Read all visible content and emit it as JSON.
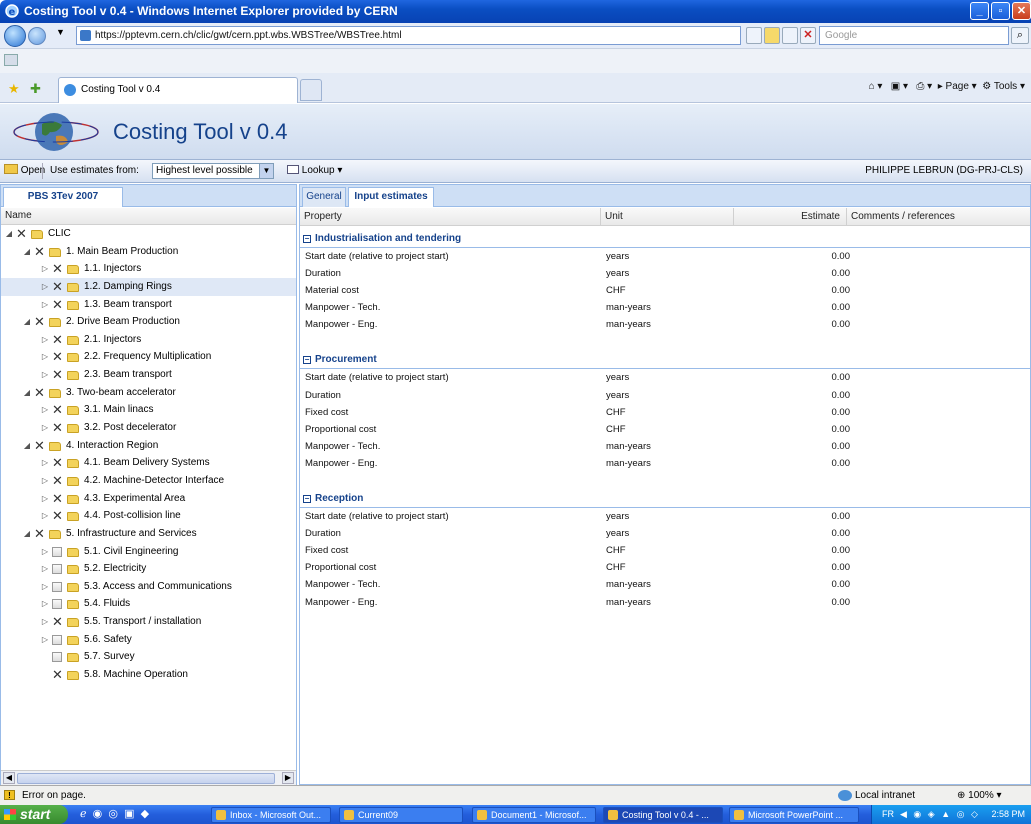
{
  "window": {
    "title": "Costing Tool v 0.4 - Windows Internet Explorer provided by CERN"
  },
  "browser": {
    "url": "https://pptevm.cern.ch/clic/gwt/cern.ppt.wbs.WBSTree/WBSTree.html",
    "search_placeholder": "Google",
    "tab_title": "Costing Tool v 0.4",
    "page_menu": "Page",
    "tools_menu": "Tools"
  },
  "app": {
    "title": "Costing Tool v 0.4",
    "open_label": "Open",
    "estimates_label": "Use estimates from:",
    "estimates_value": "Highest level possible",
    "lookup_label": "Lookup",
    "user": "PHILIPPE LEBRUN (DG-PRJ-CLS)"
  },
  "left_panel": {
    "tab": "PBS 3Tev 2007",
    "column": "Name",
    "tree": [
      {
        "label": "CLIC",
        "level": 0,
        "toggle": "expanded",
        "marker": "x"
      },
      {
        "label": "1. Main Beam Production",
        "level": 1,
        "toggle": "expanded",
        "marker": "x"
      },
      {
        "label": "1.1. Injectors",
        "level": 2,
        "toggle": "collapsed",
        "marker": "x"
      },
      {
        "label": "1.2. Damping Rings",
        "level": 2,
        "toggle": "collapsed",
        "marker": "x",
        "selected": true
      },
      {
        "label": "1.3. Beam transport",
        "level": 2,
        "toggle": "collapsed",
        "marker": "x"
      },
      {
        "label": "2. Drive Beam Production",
        "level": 1,
        "toggle": "expanded",
        "marker": "x"
      },
      {
        "label": "2.1. Injectors",
        "level": 2,
        "toggle": "collapsed",
        "marker": "x"
      },
      {
        "label": "2.2. Frequency Multiplication",
        "level": 2,
        "toggle": "collapsed",
        "marker": "x"
      },
      {
        "label": "2.3. Beam transport",
        "level": 2,
        "toggle": "collapsed",
        "marker": "x"
      },
      {
        "label": "3. Two-beam accelerator",
        "level": 1,
        "toggle": "expanded",
        "marker": "x"
      },
      {
        "label": "3.1. Main linacs",
        "level": 2,
        "toggle": "collapsed",
        "marker": "x"
      },
      {
        "label": "3.2. Post decelerator",
        "level": 2,
        "toggle": "collapsed",
        "marker": "x"
      },
      {
        "label": "4. Interaction Region",
        "level": 1,
        "toggle": "expanded",
        "marker": "x"
      },
      {
        "label": "4.1. Beam Delivery Systems",
        "level": 2,
        "toggle": "collapsed",
        "marker": "x"
      },
      {
        "label": "4.2. Machine-Detector Interface",
        "level": 2,
        "toggle": "collapsed",
        "marker": "x"
      },
      {
        "label": "4.3. Experimental Area",
        "level": 2,
        "toggle": "collapsed",
        "marker": "x"
      },
      {
        "label": "4.4. Post-collision line",
        "level": 2,
        "toggle": "collapsed",
        "marker": "x"
      },
      {
        "label": "5. Infrastructure and Services",
        "level": 1,
        "toggle": "expanded",
        "marker": "x"
      },
      {
        "label": "5.1. Civil Engineering",
        "level": 2,
        "toggle": "collapsed",
        "marker": "box"
      },
      {
        "label": "5.2. Electricity",
        "level": 2,
        "toggle": "collapsed",
        "marker": "box"
      },
      {
        "label": "5.3. Access and Communications",
        "level": 2,
        "toggle": "collapsed",
        "marker": "box"
      },
      {
        "label": "5.4. Fluids",
        "level": 2,
        "toggle": "collapsed",
        "marker": "box"
      },
      {
        "label": "5.5. Transport / installation",
        "level": 2,
        "toggle": "collapsed",
        "marker": "x"
      },
      {
        "label": "5.6. Safety",
        "level": 2,
        "toggle": "collapsed",
        "marker": "box"
      },
      {
        "label": "5.7. Survey",
        "level": 2,
        "toggle": "none",
        "marker": "box"
      },
      {
        "label": "5.8. Machine Operation",
        "level": 2,
        "toggle": "none",
        "marker": "x"
      }
    ]
  },
  "right_panel": {
    "tabs": [
      {
        "label": "General",
        "active": false
      },
      {
        "label": "Input estimates",
        "active": true
      }
    ],
    "columns": [
      "Property",
      "Unit",
      "Estimate",
      "Comments / references"
    ],
    "groups": [
      {
        "title": "Industrialisation and tendering",
        "rows": [
          {
            "property": "Start date (relative to project start)",
            "unit": "years",
            "estimate": "0.00"
          },
          {
            "property": "Duration",
            "unit": "years",
            "estimate": "0.00"
          },
          {
            "property": "Material cost",
            "unit": "CHF",
            "estimate": "0.00"
          },
          {
            "property": "Manpower - Tech.",
            "unit": "man-years",
            "estimate": "0.00"
          },
          {
            "property": "Manpower - Eng.",
            "unit": "man-years",
            "estimate": "0.00"
          }
        ]
      },
      {
        "title": "Procurement",
        "rows": [
          {
            "property": "Start date (relative to project start)",
            "unit": "years",
            "estimate": "0.00"
          },
          {
            "property": "Duration",
            "unit": "years",
            "estimate": "0.00"
          },
          {
            "property": "Fixed cost",
            "unit": "CHF",
            "estimate": "0.00"
          },
          {
            "property": "Proportional cost",
            "unit": "CHF",
            "estimate": "0.00"
          },
          {
            "property": "Manpower - Tech.",
            "unit": "man-years",
            "estimate": "0.00"
          },
          {
            "property": "Manpower - Eng.",
            "unit": "man-years",
            "estimate": "0.00"
          }
        ]
      },
      {
        "title": "Reception",
        "rows": [
          {
            "property": "Start date (relative to project start)",
            "unit": "years",
            "estimate": "0.00"
          },
          {
            "property": "Duration",
            "unit": "years",
            "estimate": "0.00"
          },
          {
            "property": "Fixed cost",
            "unit": "CHF",
            "estimate": "0.00"
          },
          {
            "property": "Proportional cost",
            "unit": "CHF",
            "estimate": "0.00"
          },
          {
            "property": "Manpower - Tech.",
            "unit": "man-years",
            "estimate": "0.00"
          },
          {
            "property": "Manpower - Eng.",
            "unit": "man-years",
            "estimate": "0.00"
          }
        ]
      }
    ]
  },
  "statusbar": {
    "message": "Error on page.",
    "zone": "Local intranet",
    "zoom": "100%"
  },
  "taskbar": {
    "start": "start",
    "tasks": [
      "Inbox - Microsoft Out...",
      "Current09",
      "Document1 - Microsof...",
      "Costing Tool v 0.4 - ...",
      "Microsoft PowerPoint ..."
    ],
    "lang": "FR",
    "time": "2:58 PM"
  },
  "colors": {
    "title_bar": "#0a4ec2",
    "panel_header": "#15428b",
    "selection": "#dfe8f6",
    "folder": "#f3d35b"
  }
}
